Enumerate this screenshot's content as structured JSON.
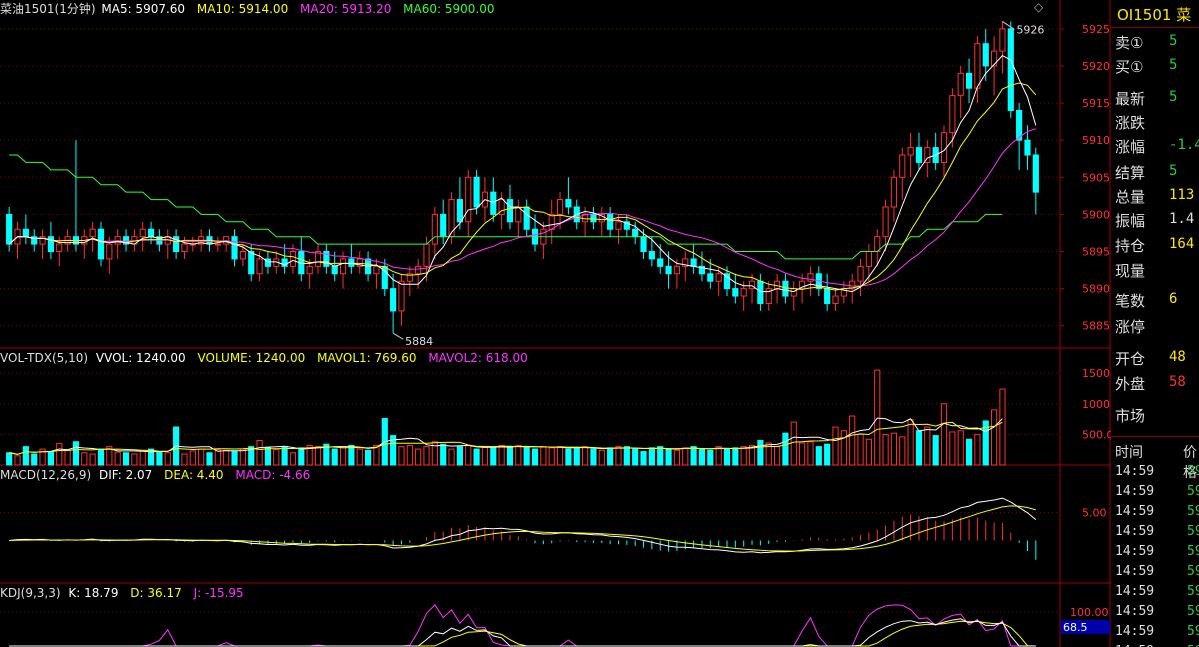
{
  "header": {
    "title": "菜油1501(1分钟)",
    "ma5": "MA5: 5907.60",
    "ma10": "MA10: 5914.00",
    "ma20": "MA20: 5913.20",
    "ma60": "MA60: 5900.00",
    "diamond": "◇"
  },
  "vol_header": {
    "name": "VOL-TDX(5,10)",
    "vvol": "VVOL: 1240.00",
    "volume": "VOLUME: 1240.00",
    "mavol1": "MAVOL1: 769.60",
    "mavol2": "MAVOL2: 618.00"
  },
  "macd_header": {
    "name": "MACD(12,26,9)",
    "dif": "DIF: 2.07",
    "dea": "DEA: 4.40",
    "macd": "MACD: -4.66"
  },
  "kdj_header": {
    "name": "KDJ(9,3,3)",
    "k": "K: 18.79",
    "d": "D: 36.17",
    "j": "J: -15.95"
  },
  "price_axis": [
    "5925",
    "5920",
    "5915",
    "5910",
    "5905",
    "5900",
    "5895",
    "5890",
    "5885"
  ],
  "vol_axis": [
    "1500",
    "1000",
    "500.00"
  ],
  "macd_axis": [
    "5.00"
  ],
  "kdj_axis": [
    "100.00"
  ],
  "kdj_marker": "68.5",
  "annotations": {
    "high": "5926",
    "low": "5884"
  },
  "quote": {
    "code": "OI1501",
    "name": "菜",
    "rows": [
      {
        "label": "卖①",
        "value": "5",
        "color": "#2ecc40"
      },
      {
        "label": "买①",
        "value": "5",
        "color": "#2ecc40"
      },
      {
        "label": "最新",
        "value": "5",
        "color": "#2ecc40"
      },
      {
        "label": "涨跌",
        "value": "",
        "color": "#2ecc40"
      },
      {
        "label": "涨幅",
        "value": "-1.4",
        "color": "#2ecc40"
      },
      {
        "label": "结算",
        "value": "5",
        "color": "#2ecc40"
      },
      {
        "label": "总量",
        "value": "113",
        "color": "#ffe600"
      },
      {
        "label": "振幅",
        "value": "1.4",
        "color": "#dddddd"
      },
      {
        "label": "持仓",
        "value": "164",
        "color": "#ffe600"
      },
      {
        "label": "现量",
        "value": "",
        "color": "#ffe600"
      },
      {
        "label": "笔数",
        "value": "6",
        "color": "#ffe600"
      },
      {
        "label": "涨停",
        "value": "",
        "color": "#ff3030"
      },
      {
        "label": "开仓",
        "value": "48",
        "color": "#ffe600"
      },
      {
        "label": "外盘",
        "value": "58",
        "color": "#ff3030"
      },
      {
        "label": "市场",
        "value": "",
        "color": "#dddddd"
      }
    ],
    "ticks_header": {
      "time": "时间",
      "price": "价格"
    },
    "ticks": [
      {
        "time": "14:59",
        "price": "59"
      },
      {
        "time": "14:59",
        "price": "59"
      },
      {
        "time": "14:59",
        "price": "59"
      },
      {
        "time": "14:59",
        "price": "59"
      },
      {
        "time": "14:59",
        "price": "59"
      },
      {
        "time": "14:59",
        "price": "59"
      },
      {
        "time": "14:59",
        "price": "59"
      },
      {
        "time": "14:59",
        "price": "59"
      },
      {
        "time": "14:59",
        "price": "59"
      },
      {
        "time": "14:59",
        "price": "59"
      }
    ]
  },
  "colors": {
    "up": "#ff3030",
    "down": "#00ffff",
    "grid": "#8b0000",
    "ma5": "#ffffff",
    "ma10": "#ffff00",
    "ma20": "#ff33ff",
    "ma60": "#33ff33"
  },
  "chart_data": {
    "type": "candlestick",
    "interval": "1 minute",
    "ylim": [
      5882,
      5927
    ],
    "candles": [
      [
        5900,
        5901,
        5895,
        5896
      ],
      [
        5896,
        5899,
        5894,
        5898
      ],
      [
        5898,
        5900,
        5896,
        5897
      ],
      [
        5897,
        5898,
        5895,
        5896
      ],
      [
        5896,
        5898,
        5894,
        5897
      ],
      [
        5897,
        5899,
        5894,
        5895
      ],
      [
        5895,
        5897,
        5893,
        5896
      ],
      [
        5896,
        5898,
        5895,
        5897
      ],
      [
        5897,
        5910,
        5895,
        5896
      ],
      [
        5896,
        5898,
        5894,
        5897
      ],
      [
        5897,
        5899,
        5895,
        5898
      ],
      [
        5898,
        5899,
        5893,
        5894
      ],
      [
        5894,
        5897,
        5892,
        5896
      ],
      [
        5896,
        5898,
        5894,
        5897
      ],
      [
        5897,
        5898,
        5895,
        5896
      ],
      [
        5896,
        5898,
        5895,
        5897
      ],
      [
        5897,
        5899,
        5895,
        5898
      ],
      [
        5898,
        5899,
        5896,
        5897
      ],
      [
        5897,
        5898,
        5895,
        5896
      ],
      [
        5896,
        5898,
        5894,
        5897
      ],
      [
        5897,
        5898,
        5894,
        5895
      ],
      [
        5895,
        5897,
        5894,
        5896
      ],
      [
        5896,
        5897,
        5895,
        5896
      ],
      [
        5896,
        5898,
        5895,
        5897
      ],
      [
        5897,
        5898,
        5895,
        5896
      ],
      [
        5896,
        5897,
        5895,
        5896
      ],
      [
        5896,
        5897,
        5895,
        5897
      ],
      [
        5897,
        5898,
        5893,
        5894
      ],
      [
        5894,
        5896,
        5893,
        5895
      ],
      [
        5895,
        5896,
        5891,
        5892
      ],
      [
        5892,
        5895,
        5891,
        5894
      ],
      [
        5894,
        5895,
        5892,
        5893
      ],
      [
        5893,
        5895,
        5892,
        5894
      ],
      [
        5894,
        5896,
        5892,
        5893
      ],
      [
        5893,
        5896,
        5892,
        5895
      ],
      [
        5895,
        5897,
        5891,
        5892
      ],
      [
        5892,
        5894,
        5890,
        5893
      ],
      [
        5893,
        5896,
        5892,
        5895
      ],
      [
        5895,
        5896,
        5892,
        5893
      ],
      [
        5893,
        5895,
        5891,
        5892
      ],
      [
        5892,
        5895,
        5890,
        5894
      ],
      [
        5894,
        5896,
        5892,
        5893
      ],
      [
        5893,
        5895,
        5892,
        5894
      ],
      [
        5894,
        5895,
        5891,
        5892
      ],
      [
        5892,
        5894,
        5890,
        5893
      ],
      [
        5893,
        5894,
        5889,
        5890
      ],
      [
        5890,
        5892,
        5884,
        5887
      ],
      [
        5887,
        5892,
        5885,
        5891
      ],
      [
        5891,
        5893,
        5889,
        5892
      ],
      [
        5892,
        5894,
        5890,
        5893
      ],
      [
        5893,
        5897,
        5891,
        5896
      ],
      [
        5896,
        5901,
        5894,
        5900
      ],
      [
        5900,
        5902,
        5896,
        5897
      ],
      [
        5897,
        5903,
        5896,
        5902
      ],
      [
        5902,
        5905,
        5898,
        5899
      ],
      [
        5899,
        5906,
        5897,
        5905
      ],
      [
        5905,
        5906,
        5900,
        5901
      ],
      [
        5901,
        5905,
        5899,
        5903
      ],
      [
        5903,
        5905,
        5899,
        5900
      ],
      [
        5900,
        5903,
        5898,
        5902
      ],
      [
        5902,
        5904,
        5898,
        5899
      ],
      [
        5899,
        5902,
        5897,
        5901
      ],
      [
        5901,
        5902,
        5897,
        5898
      ],
      [
        5898,
        5900,
        5895,
        5896
      ],
      [
        5896,
        5899,
        5894,
        5898
      ],
      [
        5898,
        5902,
        5896,
        5900
      ],
      [
        5900,
        5903,
        5898,
        5902
      ],
      [
        5902,
        5905,
        5900,
        5901
      ],
      [
        5901,
        5902,
        5898,
        5899
      ],
      [
        5899,
        5901,
        5897,
        5900
      ],
      [
        5900,
        5901,
        5898,
        5899
      ],
      [
        5899,
        5901,
        5897,
        5900
      ],
      [
        5900,
        5901,
        5897,
        5898
      ],
      [
        5898,
        5900,
        5896,
        5899
      ],
      [
        5899,
        5900,
        5897,
        5898
      ],
      [
        5898,
        5899,
        5896,
        5897
      ],
      [
        5897,
        5898,
        5894,
        5895
      ],
      [
        5895,
        5897,
        5893,
        5894
      ],
      [
        5894,
        5896,
        5892,
        5893
      ],
      [
        5893,
        5895,
        5890,
        5892
      ],
      [
        5892,
        5894,
        5890,
        5893
      ],
      [
        5893,
        5895,
        5891,
        5894
      ],
      [
        5894,
        5896,
        5892,
        5893
      ],
      [
        5893,
        5895,
        5891,
        5892
      ],
      [
        5892,
        5894,
        5890,
        5891
      ],
      [
        5891,
        5893,
        5889,
        5892
      ],
      [
        5892,
        5893,
        5889,
        5890
      ],
      [
        5890,
        5892,
        5888,
        5889
      ],
      [
        5889,
        5891,
        5887,
        5890
      ],
      [
        5890,
        5892,
        5888,
        5891
      ],
      [
        5891,
        5892,
        5887,
        5888
      ],
      [
        5888,
        5891,
        5887,
        5890
      ],
      [
        5890,
        5892,
        5888,
        5891
      ],
      [
        5891,
        5892,
        5888,
        5889
      ],
      [
        5889,
        5891,
        5887,
        5890
      ],
      [
        5890,
        5892,
        5888,
        5891
      ],
      [
        5891,
        5893,
        5889,
        5892
      ],
      [
        5892,
        5893,
        5889,
        5890
      ],
      [
        5890,
        5892,
        5887,
        5888
      ],
      [
        5888,
        5890,
        5887,
        5889
      ],
      [
        5889,
        5891,
        5888,
        5890
      ],
      [
        5890,
        5892,
        5888,
        5891
      ],
      [
        5891,
        5894,
        5889,
        5893
      ],
      [
        5893,
        5896,
        5891,
        5895
      ],
      [
        5895,
        5898,
        5893,
        5897
      ],
      [
        5897,
        5902,
        5895,
        5901
      ],
      [
        5901,
        5906,
        5899,
        5905
      ],
      [
        5905,
        5909,
        5902,
        5908
      ],
      [
        5908,
        5911,
        5905,
        5909
      ],
      [
        5909,
        5911,
        5906,
        5907
      ],
      [
        5907,
        5910,
        5905,
        5909
      ],
      [
        5909,
        5911,
        5906,
        5907
      ],
      [
        5907,
        5912,
        5905,
        5911
      ],
      [
        5911,
        5917,
        5909,
        5916
      ],
      [
        5916,
        5920,
        5913,
        5919
      ],
      [
        5919,
        5921,
        5915,
        5917
      ],
      [
        5917,
        5924,
        5915,
        5923
      ],
      [
        5923,
        5925,
        5918,
        5920
      ],
      [
        5920,
        5924,
        5916,
        5922
      ],
      [
        5922,
        5926,
        5919,
        5925
      ],
      [
        5925,
        5926,
        5913,
        5914
      ],
      [
        5914,
        5915,
        5906,
        5910
      ],
      [
        5910,
        5912,
        5906,
        5908
      ],
      [
        5908,
        5909,
        5900,
        5903
      ]
    ],
    "volume": [
      200,
      150,
      300,
      180,
      260,
      220,
      350,
      240,
      380,
      200,
      180,
      260,
      300,
      210,
      200,
      180,
      240,
      260,
      220,
      200,
      620,
      180,
      230,
      260,
      200,
      250,
      240,
      220,
      260,
      300,
      400,
      280,
      250,
      300,
      200,
      280,
      320,
      300,
      340,
      260,
      280,
      320,
      260,
      240,
      320,
      760,
      480,
      300,
      320,
      260,
      300,
      380,
      340,
      260,
      300,
      320,
      260,
      300,
      280,
      320,
      300,
      320,
      300,
      260,
      300,
      280,
      300,
      260,
      280,
      300,
      260,
      240,
      280,
      300,
      300,
      260,
      220,
      280,
      300,
      260,
      240,
      280,
      300,
      260,
      240,
      300,
      260,
      280,
      300,
      320,
      400,
      360,
      300,
      520,
      700,
      360,
      380,
      300,
      340,
      620,
      560,
      800,
      500,
      420,
      1550,
      500,
      520,
      460,
      740,
      560,
      620,
      480,
      1000,
      540,
      560,
      420,
      500,
      720,
      900,
      1240
    ],
    "ma60": [
      5908,
      5908,
      5907,
      5907,
      5907,
      5906,
      5906,
      5906,
      5905,
      5905,
      5905,
      5904,
      5904,
      5904,
      5903,
      5903,
      5903,
      5902,
      5902,
      5902,
      5901,
      5901,
      5901,
      5900,
      5900,
      5900,
      5899,
      5899,
      5899,
      5898,
      5898,
      5898,
      5897,
      5897,
      5897,
      5897,
      5897,
      5896,
      5896,
      5896,
      5896,
      5896,
      5896,
      5896,
      5896,
      5896,
      5896,
      5896,
      5896,
      5896,
      5896,
      5897,
      5897,
      5897,
      5897,
      5897,
      5897,
      5897,
      5897,
      5897,
      5897,
      5897,
      5897,
      5897,
      5897,
      5897,
      5897,
      5897,
      5897,
      5897,
      5897,
      5897,
      5897,
      5897,
      5897,
      5897,
      5897,
      5897,
      5897,
      5896,
      5896,
      5896,
      5896,
      5896,
      5896,
      5896,
      5896,
      5895,
      5895,
      5895,
      5895,
      5895,
      5895,
      5894,
      5894,
      5894,
      5894,
      5894,
      5894,
      5894,
      5894,
      5894,
      5895,
      5895,
      5895,
      5896,
      5896,
      5896,
      5897,
      5897,
      5898,
      5898,
      5898,
      5899,
      5899,
      5899,
      5899,
      5900,
      5900,
      5900
    ],
    "series_names": [
      "MA5",
      "MA10",
      "MA20",
      "MA60",
      "VOLUME",
      "MAVOL1",
      "MAVOL2",
      "DIF",
      "DEA",
      "MACD",
      "K",
      "D",
      "J"
    ]
  }
}
